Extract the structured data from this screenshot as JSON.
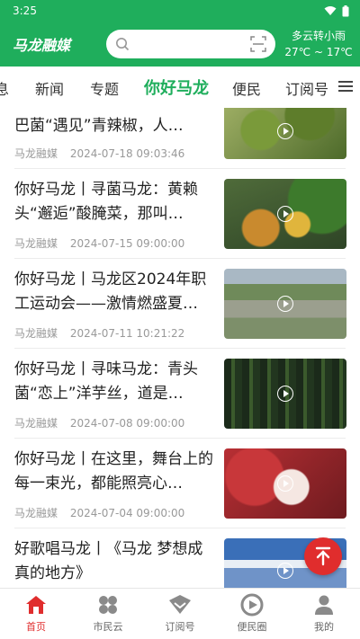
{
  "status_bar": {
    "time": "3:25"
  },
  "header": {
    "logo_text": "马龙融媒",
    "weather_line1": "多云转小雨",
    "weather_line2": "27℃ ~ 17℃"
  },
  "tabs": [
    "息",
    "新闻",
    "专题",
    "你好马龙",
    "便民",
    "订阅号"
  ],
  "active_tab": "你好马龙",
  "news": [
    {
      "title": "巴菌“遇见”青辣椒，人…",
      "source": "马龙融媒",
      "time": "2024-07-18 09:03:46"
    },
    {
      "title": "你好马龙丨寻菌马龙：黄赖头“邂逅”酸腌菜，那叫…",
      "source": "马龙融媒",
      "time": "2024-07-15 09:00:00"
    },
    {
      "title": "你好马龙丨马龙区2024年职工运动会——激情燃盛夏…",
      "source": "马龙融媒",
      "time": "2024-07-11 10:21:22"
    },
    {
      "title": "你好马龙丨寻味马龙：青头菌“恋上”洋芋丝，道是…",
      "source": "马龙融媒",
      "time": "2024-07-08 09:00:00"
    },
    {
      "title": "你好马龙丨在这里，舞台上的每一束光，都能照亮心…",
      "source": "马龙融媒",
      "time": "2024-07-04 09:00:00"
    },
    {
      "title": "好歌唱马龙丨《马龙 梦想成真的地方》",
      "source": "",
      "time": ""
    }
  ],
  "bottom_nav": [
    {
      "label": "首页",
      "icon": "home-icon"
    },
    {
      "label": "市民云",
      "icon": "clover-icon"
    },
    {
      "label": "订阅号",
      "icon": "subscribe-icon"
    },
    {
      "label": "便民圈",
      "icon": "service-circle-icon"
    },
    {
      "label": "我的",
      "icon": "user-icon"
    }
  ],
  "colors": {
    "brand_green": "#1fae5c",
    "accent_red": "#e02d2d"
  }
}
